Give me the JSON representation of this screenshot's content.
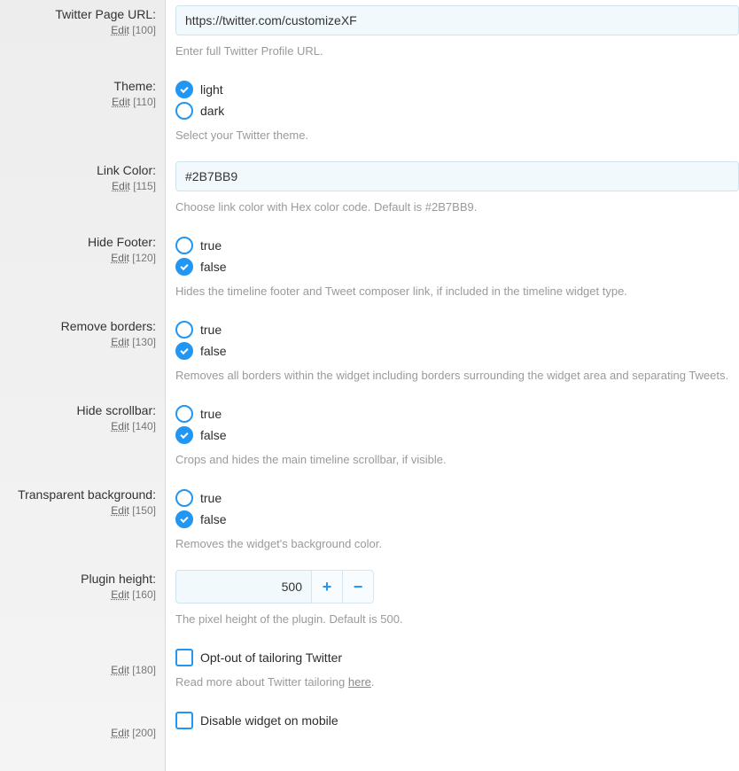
{
  "twitterUrl": {
    "label": "Twitter Page URL:",
    "edit": "Edit",
    "num": "[100]",
    "value": "https://twitter.com/customizeXF",
    "hint": "Enter full Twitter Profile URL."
  },
  "theme": {
    "label": "Theme:",
    "edit": "Edit",
    "num": "[110]",
    "opt1": "light",
    "opt2": "dark",
    "hint": "Select your Twitter theme."
  },
  "linkColor": {
    "label": "Link Color:",
    "edit": "Edit",
    "num": "[115]",
    "value": "#2B7BB9",
    "hint": "Choose link color with Hex color code. Default is #2B7BB9."
  },
  "hideFooter": {
    "label": "Hide Footer:",
    "edit": "Edit",
    "num": "[120]",
    "opt1": "true",
    "opt2": "false",
    "hint": "Hides the timeline footer and Tweet composer link, if included in the timeline widget type."
  },
  "removeBorders": {
    "label": "Remove borders:",
    "edit": "Edit",
    "num": "[130]",
    "opt1": "true",
    "opt2": "false",
    "hint": "Removes all borders within the widget including borders surrounding the widget area and separating Tweets."
  },
  "hideScrollbar": {
    "label": "Hide scrollbar:",
    "edit": "Edit",
    "num": "[140]",
    "opt1": "true",
    "opt2": "false",
    "hint": "Crops and hides the main timeline scrollbar, if visible."
  },
  "transparentBg": {
    "label": "Transparent background:",
    "edit": "Edit",
    "num": "[150]",
    "opt1": "true",
    "opt2": "false",
    "hint": "Removes the widget's background color."
  },
  "pluginHeight": {
    "label": "Plugin height:",
    "edit": "Edit",
    "num": "[160]",
    "value": "500",
    "hint": "The pixel height of the plugin. Default is 500."
  },
  "optOut": {
    "edit": "Edit",
    "num": "[180]",
    "label": "Opt-out of tailoring Twitter",
    "hintPre": "Read more about Twitter tailoring ",
    "hintLink": "here",
    "hintPost": "."
  },
  "disableMobile": {
    "edit": "Edit",
    "num": "[200]",
    "label": "Disable widget on mobile"
  }
}
